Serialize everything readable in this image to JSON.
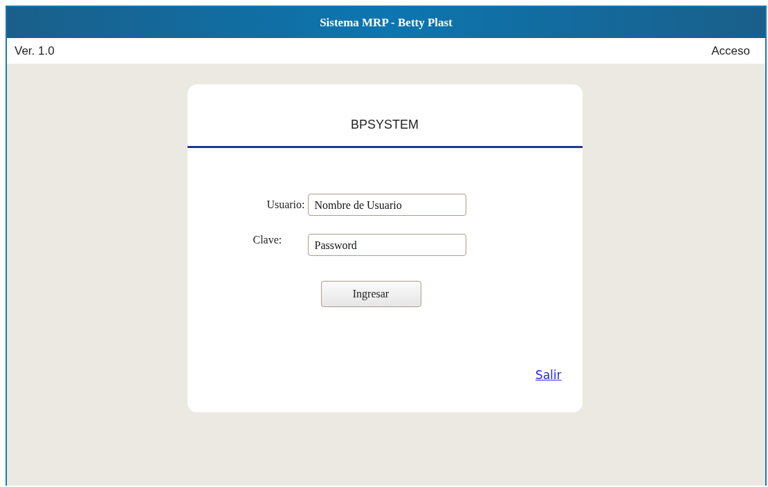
{
  "window": {
    "title": "Sistema MRP - Betty Plast"
  },
  "info_bar": {
    "version": "Ver. 1.0",
    "section": "Acceso"
  },
  "login_card": {
    "title": "BPSYSTEM",
    "fields": [
      {
        "label": "Usuario:",
        "value": "Nombre de Usuario"
      },
      {
        "label": "Clave:",
        "value": "Password"
      }
    ],
    "submit_button": "Ingresar",
    "exit_link": "Salir"
  }
}
